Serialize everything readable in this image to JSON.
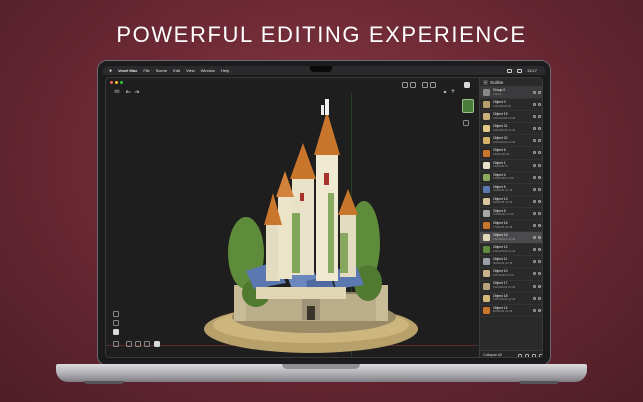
{
  "headline": "POWERFUL EDITING EXPERIENCE",
  "menubar": {
    "app_name": "Voxel Max",
    "items": [
      "File",
      "Scene",
      "Edit",
      "View",
      "Window",
      "Help"
    ],
    "clock": "13:17"
  },
  "scene": {
    "subject": "castle-model",
    "colors": {
      "foliage": "#5e8c3a",
      "roof": "#c9762d",
      "wall": "#e8e2c8",
      "blue_roof": "#5b78b0",
      "ground": "#b8a06a"
    }
  },
  "outline": {
    "title": "Outline",
    "rows": [
      {
        "name": "Group 0",
        "sub": "3 items",
        "kind": "group",
        "color": "#888888"
      },
      {
        "name": "Object 0",
        "sub": "150x150x90 98",
        "color": "#b8a06a"
      },
      {
        "name": "Object 19",
        "sub": "190x120x80 m2 48",
        "color": "#c9b07a"
      },
      {
        "name": "Object 21",
        "sub": "100x100x50 m2 40",
        "color": "#e3c886"
      },
      {
        "name": "Object 22",
        "sub": "100x120x40 m2 40",
        "color": "#d6b26a"
      },
      {
        "name": "Object 6",
        "sub": "18x18x100 96",
        "color": "#c9762d"
      },
      {
        "name": "Object 1",
        "sub": "24x24x81 97",
        "color": "#e8e2c8"
      },
      {
        "name": "Object 4",
        "sub": "120x80x38 m2 48",
        "color": "#8aa85a"
      },
      {
        "name": "Object 5",
        "sub": "42x42x60 m2 48",
        "color": "#5b78b0"
      },
      {
        "name": "Object 13",
        "sub": "40x40x38 m2 48",
        "color": "#d9c79a"
      },
      {
        "name": "Object 8",
        "sub": "100x80x30 m2 48",
        "color": "#a7a7a7"
      },
      {
        "name": "Object 16",
        "sub": "77x68x50 m2 48",
        "color": "#c9762d"
      },
      {
        "name": "Object 15",
        "sub": "150x150x40 m2 48",
        "color": "#e0d8b8",
        "kind": "selected"
      },
      {
        "name": "Object 12",
        "sub": "100x120x64 m2 48",
        "color": "#5e8c3a"
      },
      {
        "name": "Object 11",
        "sub": "50x50x50 m2 48",
        "color": "#9aa0aa"
      },
      {
        "name": "Object 10",
        "sub": "100x70x40 m2 48",
        "color": "#c8b488"
      },
      {
        "name": "Object 17",
        "sub": "100x100x34 m2 48",
        "color": "#b9a27a"
      },
      {
        "name": "Object 18",
        "sub": "120x140x34 m2 48",
        "color": "#d4b87a"
      },
      {
        "name": "Object 14",
        "sub": "60x60x60 m2 48",
        "color": "#c9762d"
      }
    ],
    "footer": "Collapse All"
  }
}
